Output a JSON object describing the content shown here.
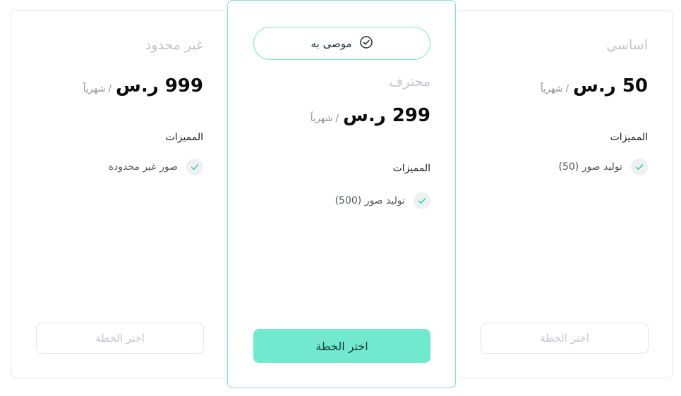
{
  "colors": {
    "accent": "#72e8cf",
    "accent_border": "#7fe3cc",
    "check_color": "#3ccfae",
    "muted_text": "#c2c5cb"
  },
  "plans": {
    "unlimited": {
      "name": "غير محدود",
      "price": "999 ر.س",
      "period": "شهرياً",
      "slash": "/",
      "features_title": "المميزات",
      "feature": "صور غير محدودة",
      "feature_icon": "check-icon",
      "button": "اختر الخطة"
    },
    "pro": {
      "badge": "موصى به",
      "badge_icon": "check-circle-icon",
      "name": "محترف",
      "price": "299 ر.س",
      "period": "شهرياً",
      "slash": "/",
      "features_title": "المميزات",
      "feature": "توليد صور (500)",
      "feature_icon": "check-icon",
      "button": "اختر الخطة"
    },
    "basic": {
      "name": "اساسي",
      "price": "50 ر.س",
      "period": "شهرياً",
      "slash": "/",
      "features_title": "المميزات",
      "feature": "توليد صور (50)",
      "feature_icon": "check-icon",
      "button": "اختر الخطة"
    }
  }
}
